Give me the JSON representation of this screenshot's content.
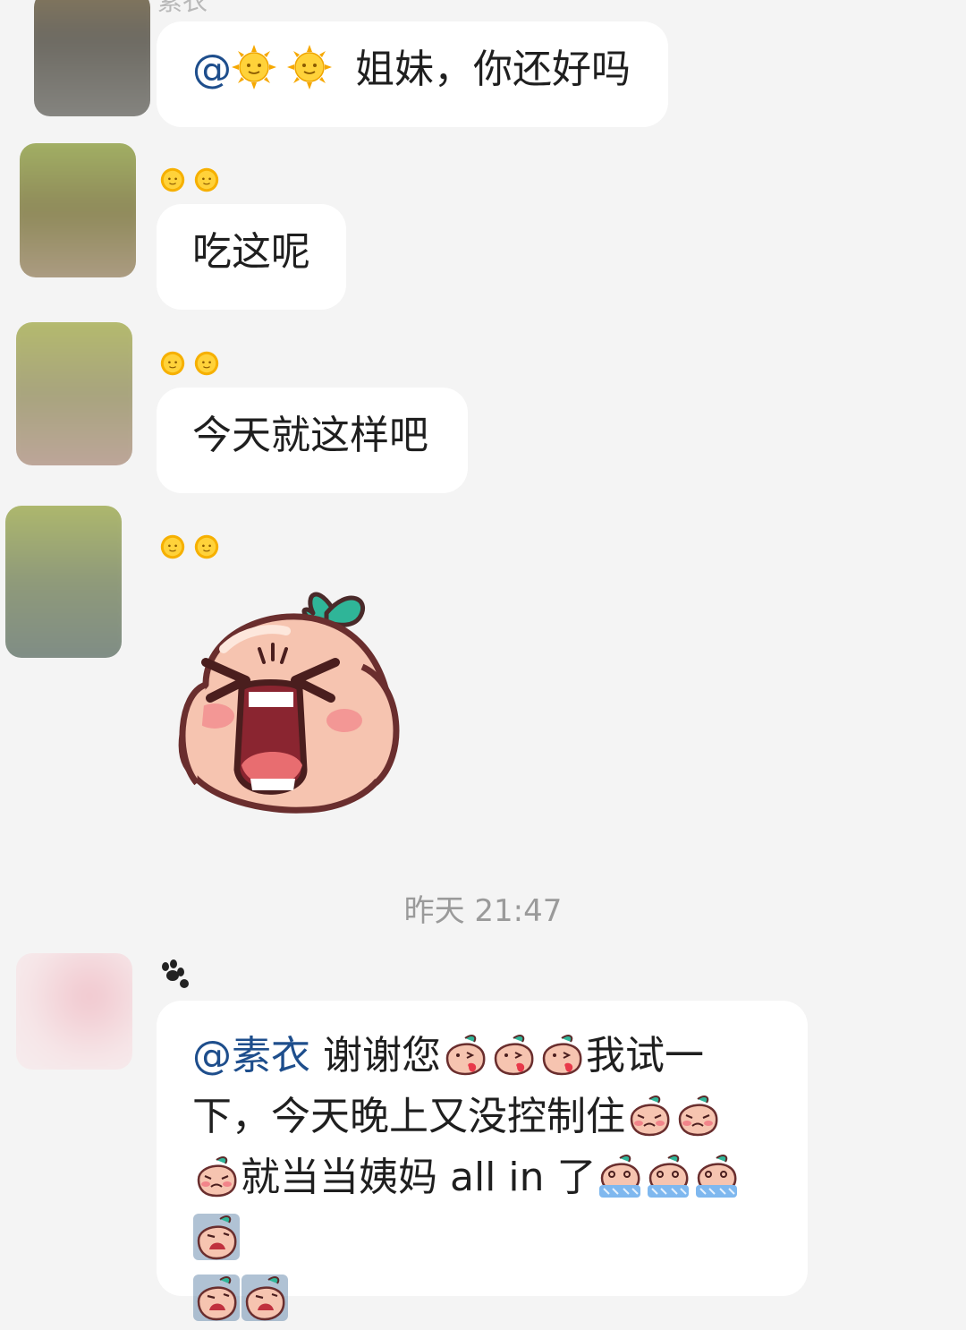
{
  "top_name": "素衣",
  "messages": [
    {
      "id": "m1",
      "mention": "@",
      "text": " 姐妹，你还好吗",
      "emoji_count": 2
    },
    {
      "id": "m2",
      "name_emojis": 2,
      "text": "吃这呢"
    },
    {
      "id": "m3",
      "name_emojis": 2,
      "text": "今天就这样吧"
    },
    {
      "id": "m4",
      "name_emojis": 2,
      "sticker": "peach-screaming-sticker"
    }
  ],
  "timestamp": "昨天 21:47",
  "last_message": {
    "mention": "@素衣",
    "seg1": " 谢谢您",
    "seg2": "我试一",
    "line2": "下，今天晚上又没控制住",
    "seg3": "就当当姨妈 all in 了"
  },
  "colors": {
    "background": "#f4f4f4",
    "bubble": "#ffffff",
    "mention": "#1e4e8c",
    "timestamp": "#9a9a9a"
  }
}
